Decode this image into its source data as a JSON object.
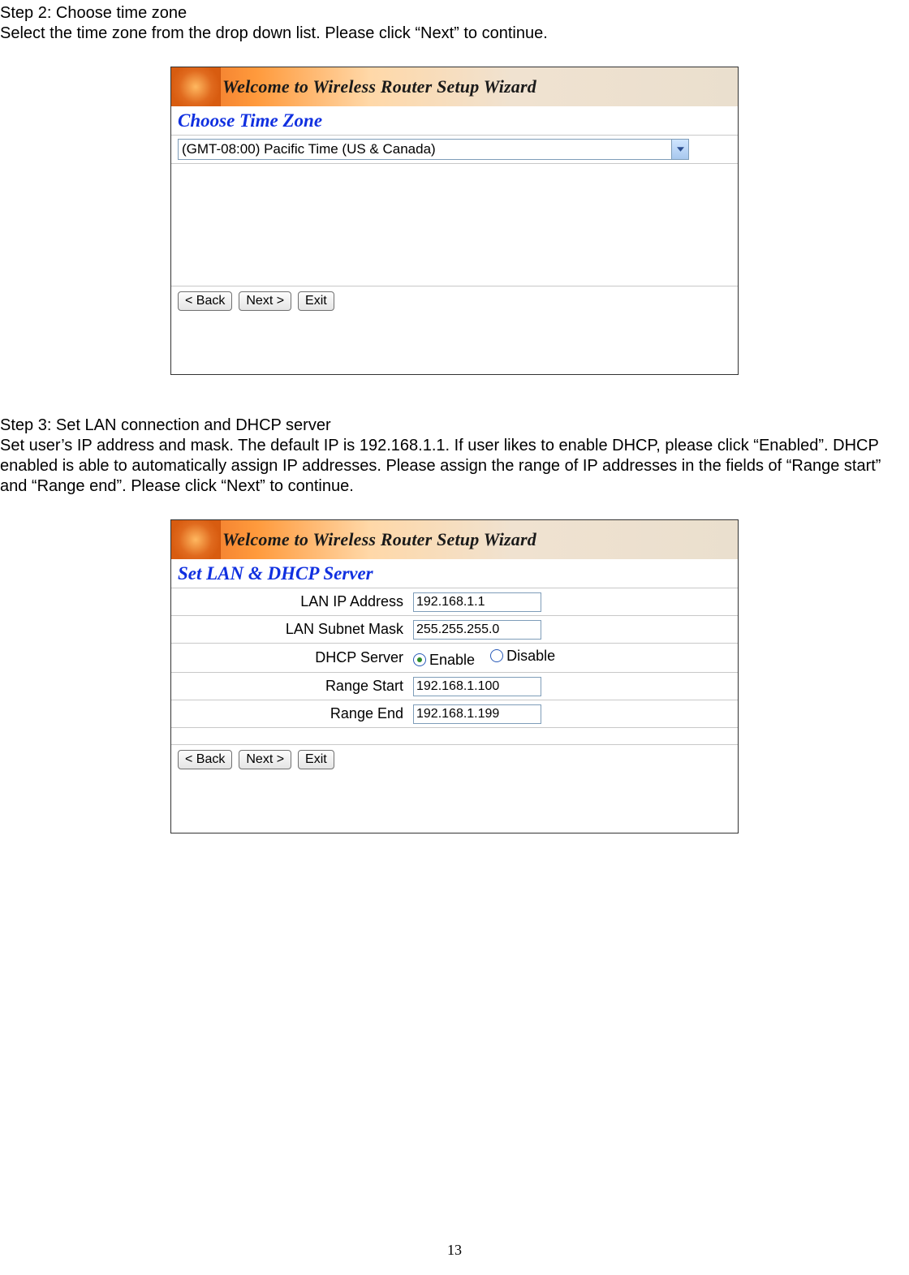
{
  "step2": {
    "title": "Step 2: Choose time zone",
    "desc": "Select the time zone from the drop down list. Please click “Next” to continue."
  },
  "step3": {
    "title": "Step 3: Set LAN connection and DHCP server",
    "desc": "Set user’s IP address and mask. The default IP is 192.168.1.1. If user likes to enable DHCP, please click “Enabled”. DHCP enabled is able to automatically assign IP addresses. Please assign the range of IP addresses in the fields of “Range start” and “Range end”. Please click “Next” to continue."
  },
  "wizard": {
    "banner": "Welcome to Wireless Router Setup Wizard",
    "heading_tz": "Choose Time Zone",
    "heading_lan": "Set LAN & DHCP Server",
    "tz_value": "(GMT-08:00) Pacific Time (US & Canada)",
    "buttons": {
      "back": "< Back",
      "next": "Next >",
      "exit": "Exit"
    }
  },
  "lan": {
    "labels": {
      "ip": "LAN IP Address",
      "mask": "LAN Subnet Mask",
      "dhcp": "DHCP Server",
      "rstart": "Range Start",
      "rend": "Range End"
    },
    "values": {
      "ip": "192.168.1.1",
      "mask": "255.255.255.0",
      "rstart": "192.168.1.100",
      "rend": "192.168.1.199"
    },
    "radio": {
      "enable": "Enable",
      "disable": "Disable"
    }
  },
  "page_number": "13"
}
